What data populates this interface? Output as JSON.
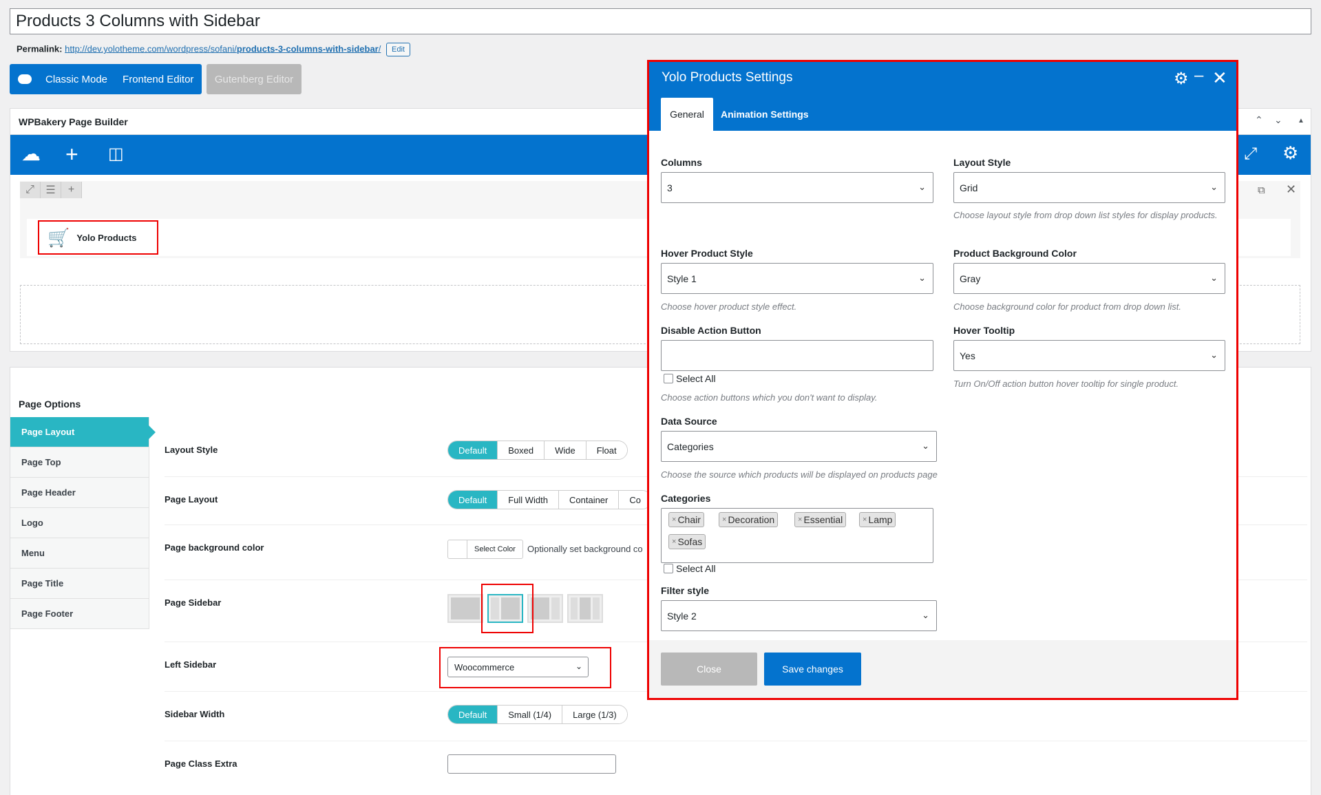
{
  "post": {
    "title": "Products 3 Columns with Sidebar",
    "permalink_label": "Permalink:",
    "permalink_base": "http://dev.yolotheme.com/wordpress/sofani/",
    "permalink_slug": "products-3-columns-with-sidebar",
    "permalink_trail": "/",
    "edit_label": "Edit"
  },
  "modes": {
    "classic": "Classic Mode",
    "frontend": "Frontend Editor",
    "gutenberg": "Gutenberg Editor"
  },
  "builder": {
    "title": "WPBakery Page Builder",
    "element_name": "Yolo Products",
    "accent": "#0473ce"
  },
  "page_options": {
    "title": "Page Options",
    "nav": [
      "Page Layout",
      "Page Top",
      "Page Header",
      "Logo",
      "Menu",
      "Page Title",
      "Page Footer"
    ],
    "active_nav": "Page Layout",
    "layout_style": {
      "label": "Layout Style",
      "options": [
        "Default",
        "Boxed",
        "Wide",
        "Float"
      ],
      "selected": "Default"
    },
    "page_layout": {
      "label": "Page Layout",
      "options": [
        "Default",
        "Full Width",
        "Container",
        "Co"
      ],
      "selected": "Default"
    },
    "bg_color": {
      "label": "Page background color",
      "button": "Select Color",
      "hint": "Optionally set background co"
    },
    "page_sidebar": {
      "label": "Page Sidebar"
    },
    "left_sidebar": {
      "label": "Left Sidebar",
      "value": "Woocommerce"
    },
    "sidebar_width": {
      "label": "Sidebar Width",
      "options": [
        "Default",
        "Small (1/4)",
        "Large (1/3)"
      ],
      "selected": "Default"
    },
    "class_extra": {
      "label": "Page Class Extra",
      "value": ""
    },
    "accent": "#29b6c3"
  },
  "modal": {
    "title": "Yolo Products Settings",
    "tabs": [
      "General",
      "Animation Settings"
    ],
    "active_tab": "General",
    "columns": {
      "label": "Columns",
      "value": "3"
    },
    "layout_style": {
      "label": "Layout Style",
      "value": "Grid",
      "hint": "Choose layout style from drop down list styles for display products."
    },
    "hover_style": {
      "label": "Hover Product Style",
      "value": "Style 1",
      "hint": "Choose hover product style effect."
    },
    "bg_color": {
      "label": "Product Background Color",
      "value": "Gray",
      "hint": "Choose background color for product from drop down list."
    },
    "disable_action": {
      "label": "Disable Action Button",
      "select_all": "Select All",
      "hint": "Choose action buttons which you don't want to display."
    },
    "hover_tooltip": {
      "label": "Hover Tooltip",
      "value": "Yes",
      "hint": "Turn On/Off action button hover tooltip for single product."
    },
    "data_source": {
      "label": "Data Source",
      "value": "Categories",
      "hint": "Choose the source which products will be displayed on products page"
    },
    "categories": {
      "label": "Categories",
      "tags": [
        "Chair",
        "Decoration",
        "Essential",
        "Lamp",
        "Sofas"
      ],
      "select_all": "Select All"
    },
    "filter_style": {
      "label": "Filter style",
      "value": "Style 2"
    },
    "close_label": "Close",
    "save_label": "Save changes"
  }
}
